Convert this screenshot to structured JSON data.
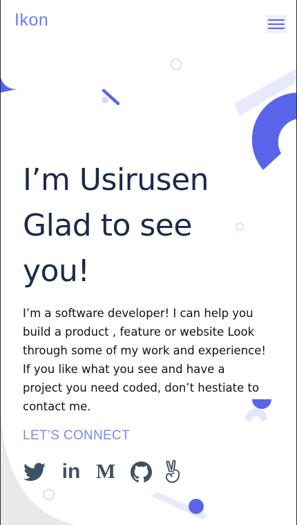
{
  "header": {
    "logo": "Ikon",
    "menu_icon": "hamburger-menu-icon"
  },
  "hero": {
    "headline_lines": [
      "I’m Usirusen",
      "Glad to see",
      "you!"
    ],
    "bio_lines": [
      "I’m a software developer! I can help you",
      "build a product , feature or website Look",
      "through some of my work and experience!",
      "If you like what you see and have a",
      "project you need coded, don’t hestiate to",
      "contact me."
    ],
    "connect_label": "LET’S CONNECT"
  },
  "social": [
    {
      "name": "twitter",
      "icon": "twitter-icon"
    },
    {
      "name": "linkedin",
      "icon": "linkedin-icon",
      "glyph": "in"
    },
    {
      "name": "medium",
      "icon": "medium-icon",
      "glyph": "M"
    },
    {
      "name": "github",
      "icon": "github-icon"
    },
    {
      "name": "angellist",
      "icon": "angellist-icon"
    }
  ],
  "colors": {
    "accent": "#5864ea",
    "accent_light": "#7b86f2",
    "deco_pale": "#e8eafc",
    "heading": "#1b2a4a",
    "icon": "#3e5066"
  }
}
